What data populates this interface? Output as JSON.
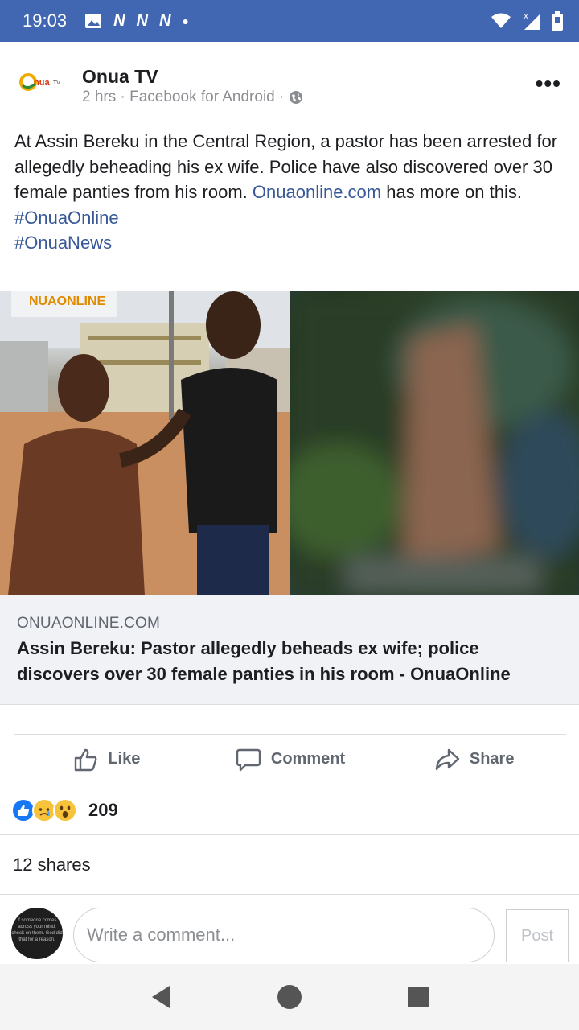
{
  "status_bar": {
    "time": "19:03",
    "notif_letters": [
      "N",
      "N",
      "N"
    ]
  },
  "post": {
    "page_logo_text": "Onua",
    "page_logo_sub": "TV",
    "page_name": "Onua TV",
    "meta": "2 hrs · Facebook for Android ·",
    "text_main": "At Assin Bereku in the Central Region, a pastor has been arrested for allegedly beheading his ex wife. Police have also discovered over 30 female panties from his room. ",
    "text_link": "Onuaonline.com",
    "text_after_link": " has more on this.",
    "hashtags": [
      "#OnuaOnline",
      "#OnuaNews"
    ],
    "image_watermark": "NUAONLINE"
  },
  "link_preview": {
    "domain": "ONUAONLINE.COM",
    "title": "Assin Bereku: Pastor allegedly beheads ex wife; police discovers over 30 female panties in his room - OnuaOnline"
  },
  "actions": {
    "like": "Like",
    "comment": "Comment",
    "share": "Share"
  },
  "reactions": {
    "count": "209"
  },
  "shares": "12 shares",
  "composer": {
    "placeholder": "Write a comment...",
    "post_label": "Post",
    "avatar_text": "If someone comes across your mind, check on them. God did that for a reason."
  },
  "colors": {
    "brand": "#4267b2",
    "link": "#385898"
  }
}
